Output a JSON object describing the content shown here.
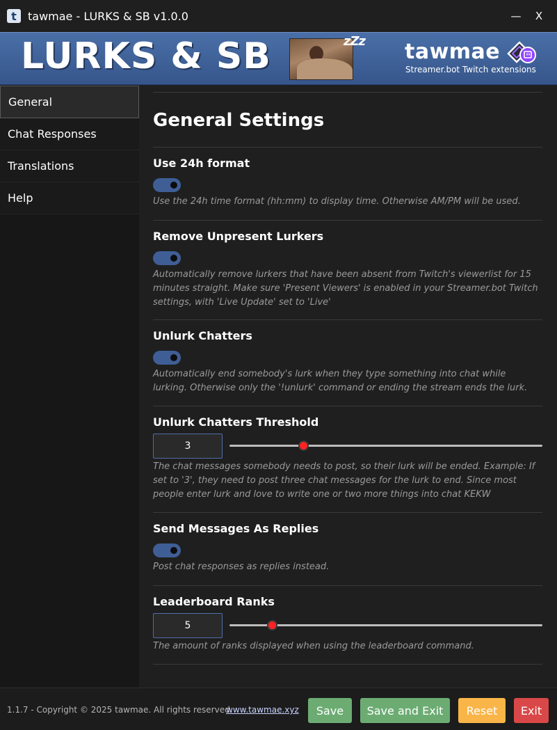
{
  "window": {
    "app_icon_letter": "t",
    "title": "tawmae - LURKS & SB v1.0.0",
    "minimize_glyph": "—",
    "close_glyph": "X"
  },
  "banner": {
    "title": "LURKS & SB",
    "zzz": "zZz",
    "brand_name": "tawmae",
    "brand_tagline": "Streamer.bot Twitch extensions"
  },
  "sidebar": {
    "items": [
      {
        "label": "General",
        "active": true
      },
      {
        "label": "Chat Responses",
        "active": false
      },
      {
        "label": "Translations",
        "active": false
      },
      {
        "label": "Help",
        "active": false
      }
    ]
  },
  "main": {
    "title": "General Settings",
    "settings": [
      {
        "title": "Use 24h format",
        "type": "toggle",
        "enabled": true,
        "description": "Use the 24h time format (hh:mm) to display time. Otherwise AM/PM will be used."
      },
      {
        "title": "Remove Unpresent Lurkers",
        "type": "toggle",
        "enabled": true,
        "description": "Automatically remove lurkers that have been absent from Twitch's viewerlist for 15 minutes straight. Make sure 'Present Viewers' is enabled in your Streamer.bot Twitch settings, with 'Live Update' set to 'Live'"
      },
      {
        "title": "Unlurk Chatters",
        "type": "toggle",
        "enabled": true,
        "description": "Automatically end somebody's lurk when they type something into chat while lurking. Otherwise only the '!unlurk' command or ending the stream ends the lurk."
      },
      {
        "title": "Unlurk Chatters Threshold",
        "type": "slider",
        "value": "3",
        "slider_fraction": 0.235,
        "description": "The chat messages somebody needs to post, so their lurk will be ended. Example: If set to '3', they need to post three chat messages for the lurk to end. Since most people enter lurk and love to write one or two more things into chat KEKW"
      },
      {
        "title": "Send Messages As Replies",
        "type": "toggle",
        "enabled": true,
        "description": "Post chat responses as replies instead."
      },
      {
        "title": "Leaderboard Ranks",
        "type": "slider",
        "value": "5",
        "slider_fraction": 0.135,
        "description": "The amount of ranks displayed when using the leaderboard command."
      }
    ]
  },
  "footer": {
    "copyright": "1.1.7 - Copyright © 2025 tawmae. All rights reserved.",
    "link": "www.tawmae.xyz",
    "save_label": "Save",
    "save_exit_label": "Save and Exit",
    "reset_label": "Reset",
    "exit_label": "Exit"
  },
  "colors": {
    "accent": "#3f5e96",
    "save": "#6cac73",
    "reset": "#f9b548",
    "exit": "#d94848",
    "slider_thumb": "#ff2222"
  }
}
